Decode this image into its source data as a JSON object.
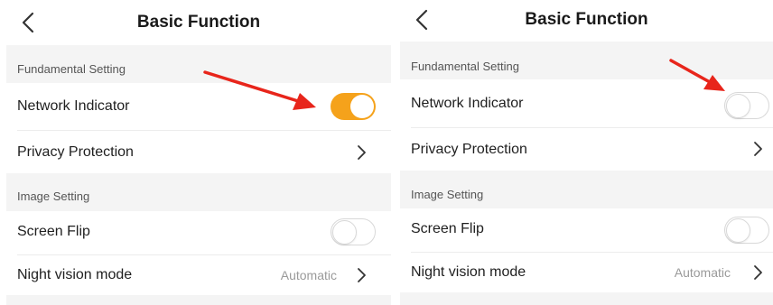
{
  "colors": {
    "accent": "#f5a21b",
    "annotation_arrow": "#e8251b"
  },
  "icons": {
    "back": "chevron-left-icon",
    "forward": "chevron-right-icon"
  },
  "panels": [
    {
      "title": "Basic Function",
      "sections": [
        {
          "label": "Fundamental Setting"
        },
        {
          "label": "Image Setting"
        }
      ],
      "rows": {
        "network_indicator": {
          "label": "Network Indicator",
          "toggle_on": true
        },
        "privacy_protection": {
          "label": "Privacy Protection"
        },
        "screen_flip": {
          "label": "Screen Flip",
          "toggle_on": false
        },
        "night_vision": {
          "label": "Night vision mode",
          "value": "Automatic"
        }
      }
    },
    {
      "title": "Basic Function",
      "sections": [
        {
          "label": "Fundamental Setting"
        },
        {
          "label": "Image Setting"
        }
      ],
      "rows": {
        "network_indicator": {
          "label": "Network Indicator",
          "toggle_on": false
        },
        "privacy_protection": {
          "label": "Privacy Protection"
        },
        "screen_flip": {
          "label": "Screen Flip",
          "toggle_on": false
        },
        "night_vision": {
          "label": "Night vision mode",
          "value": "Automatic"
        }
      }
    }
  ]
}
